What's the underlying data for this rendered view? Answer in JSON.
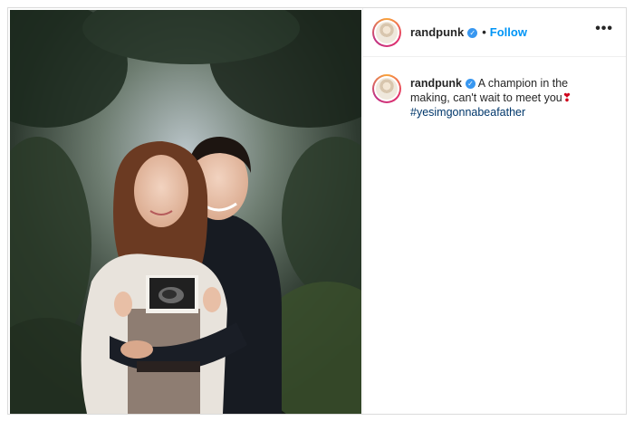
{
  "post": {
    "username": "randpunk",
    "follow_label": "Follow",
    "separator": "•",
    "more_label": "•••",
    "verified_glyph": "✓",
    "caption": {
      "text": "A champion in the making, can't wait to meet you",
      "emoji": "❣",
      "hashtag": "#yesimgonnabeafather"
    },
    "image_alt": "Couple holding an ultrasound photo outdoors"
  },
  "icons": {
    "verified": "verified-badge-icon",
    "more": "more-options-icon"
  },
  "colors": {
    "follow": "#0095f6",
    "verified": "#3897f0",
    "hashtag": "#00376b",
    "heart": "#d0021b",
    "border": "#dbdbdb"
  }
}
